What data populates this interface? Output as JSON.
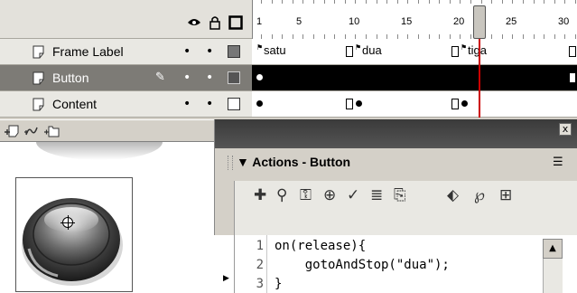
{
  "timeline": {
    "header_icons": [
      "eye-icon",
      "lock-icon",
      "outline-icon"
    ],
    "ruler_numbers": [
      "1",
      "5",
      "10",
      "15",
      "20",
      "25",
      "30"
    ],
    "layers": [
      {
        "name": "Frame Label",
        "selected": false
      },
      {
        "name": "Button",
        "selected": true
      },
      {
        "name": "Content",
        "selected": false
      }
    ],
    "frame_labels": [
      "satu",
      "dua",
      "tiga"
    ],
    "current_frame": "20"
  },
  "layer_tools": [
    "add-layer-icon",
    "add-guide-icon",
    "add-folder-icon"
  ],
  "actions_panel": {
    "title": "Actions - Button",
    "close_label": "x",
    "code_lines": [
      {
        "num": "1",
        "code": "on(release){"
      },
      {
        "num": "2",
        "code": "    gotoAndStop(\"dua\");"
      },
      {
        "num": "3",
        "code": "}"
      }
    ]
  },
  "colors": {
    "selected_layer_bg": "#7d7b76",
    "panel_bg": "#d4d0c8",
    "playhead": "#cc0000"
  }
}
